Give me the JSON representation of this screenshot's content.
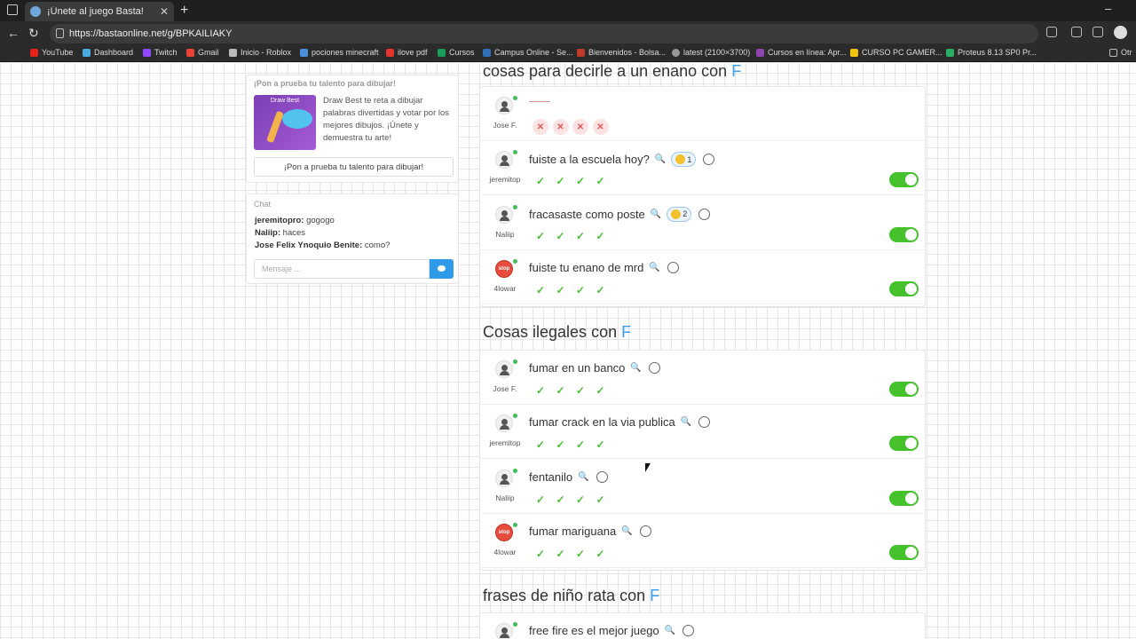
{
  "browser": {
    "tab_title": "¡Únete al juego Basta!",
    "url": "https://bastaonline.net/g/BPKAILIAKY",
    "bookmarks": [
      "YouTube",
      "Dashboard",
      "Twitch",
      "Gmail",
      "Inicio - Roblox",
      "pociones minecraft",
      "ilove pdf",
      "Cursos",
      "Campus Online - Se...",
      "Bienvenidos - Bolsa...",
      "latest (2100×3700)",
      "Cursos en línea: Apr...",
      "CURSO PC GAMER...",
      "Proteus 8.13 SP0 Pr...",
      "Otr"
    ]
  },
  "promo": {
    "heading": "¡Pon a prueba tu talento para dibujar!",
    "brand": "Draw Best",
    "text": "Draw Best te reta a dibujar palabras divertidas y votar por los mejores dibujos. ¡Únete y demuestra tu arte!",
    "button": "¡Pon a prueba tu talento para dibujar!"
  },
  "chat": {
    "heading": "Chat",
    "messages": [
      {
        "user": "jeremitopro:",
        "text": " gogogo"
      },
      {
        "user": "Naliip:",
        "text": " haces"
      },
      {
        "user": "Jose Felix Ynoquio Benite:",
        "text": " como?"
      }
    ],
    "placeholder": "Mensaje ..."
  },
  "sections": [
    {
      "title": "cosas para decirle a un enano con ",
      "letter": "F"
    },
    {
      "title": "Cosas ilegales con ",
      "letter": "F"
    },
    {
      "title": "frases de niño rata con ",
      "letter": "F"
    }
  ],
  "rows": {
    "s1": [
      {
        "user": "Jose F.",
        "answer": "",
        "marks": "bad"
      },
      {
        "user": "jeremitop",
        "answer": "fuiste a la escuela hoy?",
        "react": "1",
        "marks": "ok"
      },
      {
        "user": "Naliip",
        "answer": "fracasaste como poste",
        "react": "2",
        "marks": "ok"
      },
      {
        "user": "4lowar",
        "answer": "fuiste tu enano de mrd",
        "marks": "ok"
      }
    ],
    "s2": [
      {
        "user": "Jose F.",
        "answer": "fumar en un banco",
        "marks": "ok"
      },
      {
        "user": "jeremitop",
        "answer": "fumar crack en la via publica",
        "marks": "ok"
      },
      {
        "user": "Naliip",
        "answer": "fentanilo",
        "marks": "ok"
      },
      {
        "user": "4lowar",
        "answer": "fumar mariguana",
        "marks": "ok"
      }
    ],
    "s3": [
      {
        "user": "",
        "answer": "free fire es el mejor juego",
        "marks": "ok"
      }
    ]
  },
  "stop_label": "stop",
  "colors": {
    "accent": "#3d9be9",
    "toggle_on": "#44c12b",
    "ok": "#4bbf35",
    "bad": "#e05a5a"
  }
}
